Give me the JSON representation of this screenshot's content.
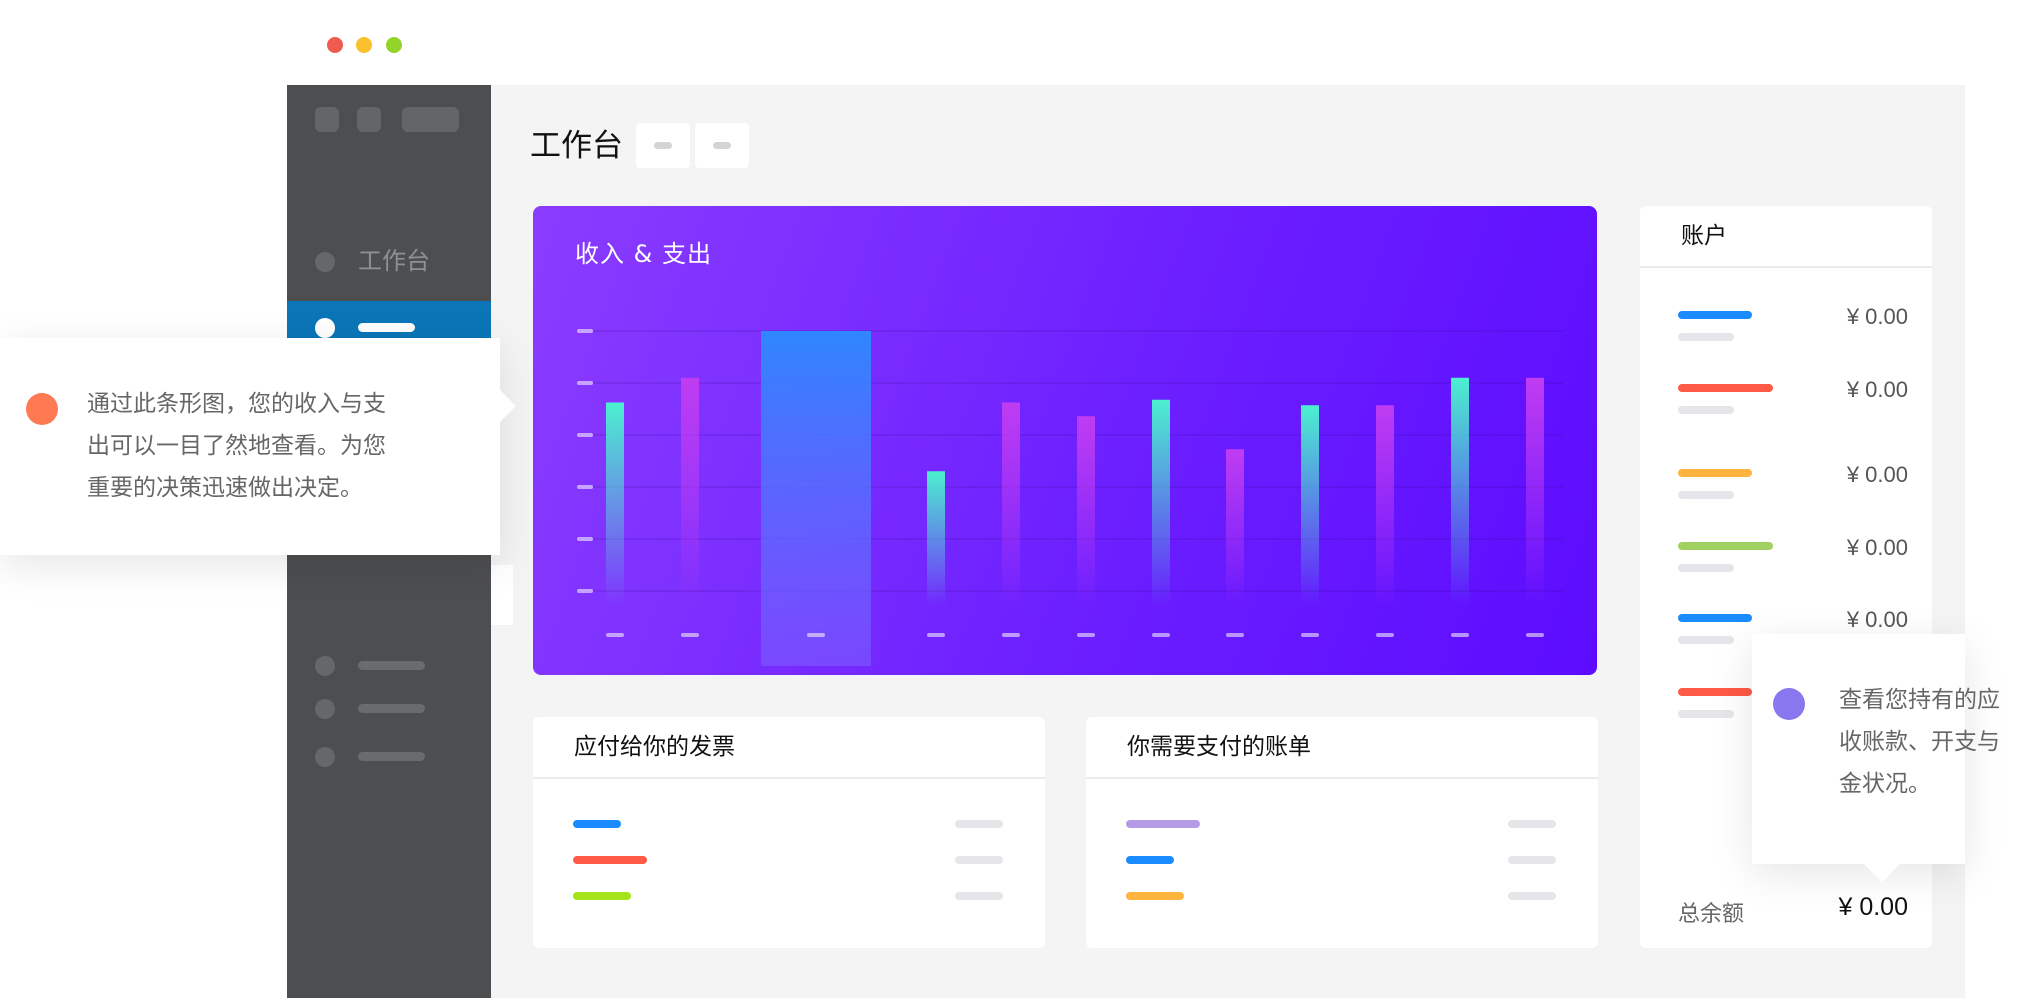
{
  "window": {
    "traffic_colors": [
      "#f05b4f",
      "#fbc02d",
      "#93d32a"
    ]
  },
  "sidebar": {
    "items": [
      {
        "label": "工作台",
        "state": "inactive"
      },
      {
        "label": "",
        "state": "active"
      },
      {
        "label": "",
        "state": "inactive"
      },
      {
        "label": "",
        "state": "inactive"
      },
      {
        "label": "",
        "state": "inactive"
      },
      {
        "label": "",
        "state": "inactive"
      }
    ]
  },
  "header": {
    "title": "工作台"
  },
  "income_chart": {
    "title": "收入 & 支出"
  },
  "chart_data": {
    "type": "bar",
    "title": "收入 & 支出",
    "categories": [
      "",
      "",
      "",
      "",
      "",
      "",
      "",
      "",
      "",
      "",
      "",
      ""
    ],
    "values": [
      0.74,
      0.83,
      1.0,
      0.49,
      0.74,
      0.69,
      0.75,
      0.57,
      0.73,
      0.73,
      0.83,
      0.83
    ],
    "colors": {
      "income": "#4cf0cf",
      "expense": "#c03cf2",
      "highlight": "#2f86ff"
    },
    "ylim": [
      0,
      1
    ],
    "grid": true
  },
  "invoices": {
    "title": "应付给你的发票",
    "rows": [
      {
        "color": "#1a8cff"
      },
      {
        "color": "#ff5a46"
      },
      {
        "color": "#a4e51a"
      }
    ]
  },
  "bills": {
    "title": "你需要支付的账单",
    "rows": [
      {
        "color": "#b49be8"
      },
      {
        "color": "#1a8cff"
      },
      {
        "color": "#ffb43f"
      }
    ]
  },
  "accounts": {
    "title": "账户",
    "rows": [
      {
        "color": "#1a8cff",
        "value": "¥ 0.00"
      },
      {
        "color": "#ff5a46",
        "value": "¥ 0.00"
      },
      {
        "color": "#ffb43f",
        "value": "¥ 0.00"
      },
      {
        "color": "#a0d060",
        "value": "¥ 0.00"
      },
      {
        "color": "#1a8cff",
        "value": "¥ 0.00"
      },
      {
        "color": "#ff5a46",
        "value": ""
      }
    ],
    "total_label": "总余额",
    "total_value": "¥ 0.00"
  },
  "tooltips": {
    "left": {
      "line1": "通过此条形图，您的收入与支",
      "line2": "出可以一目了然地查看。为您",
      "line3": "重要的决策迅速做出决定。",
      "dot_color": "#ff7a52"
    },
    "right": {
      "line1": "查看您持有的应",
      "line2": "收账款、开支与",
      "line3": "金状况。",
      "dot_color": "#8877ee"
    }
  }
}
